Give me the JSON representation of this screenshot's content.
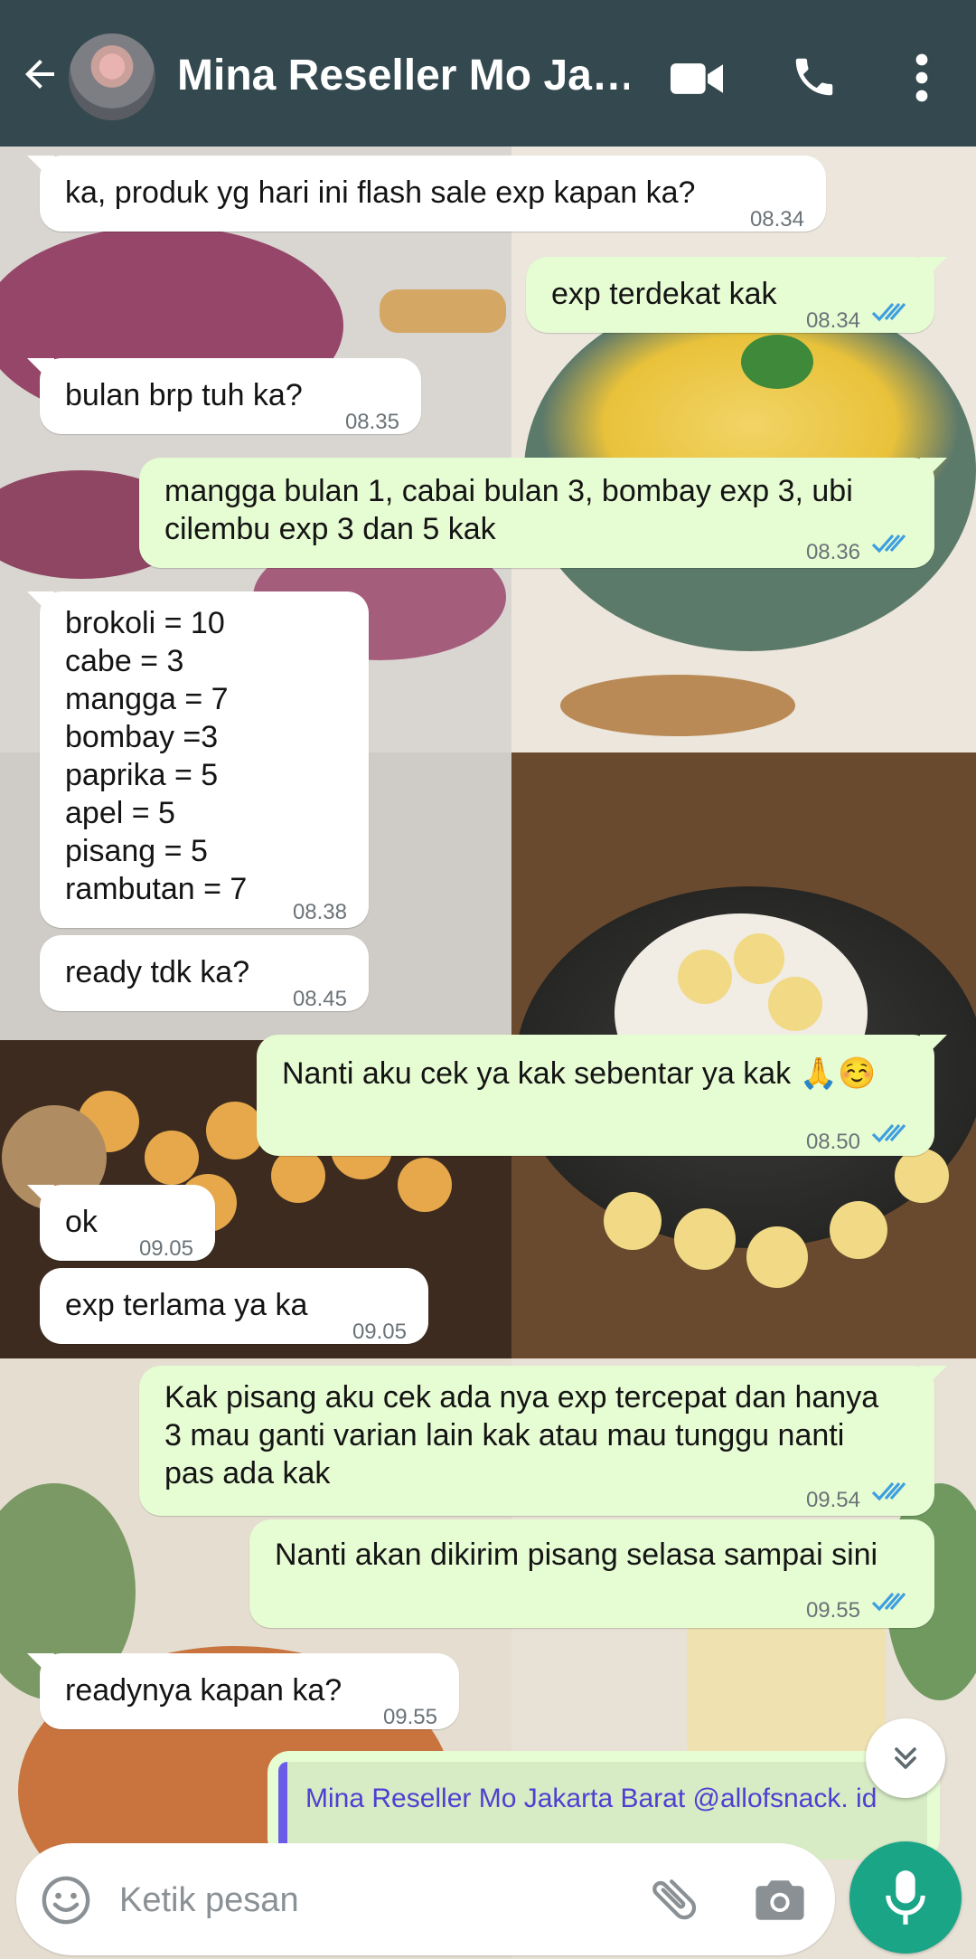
{
  "header": {
    "contact_name": "Mina Reseller Mo Ja…"
  },
  "messages": [
    {
      "dir": "in",
      "text": "ka, produk yg hari ini flash sale exp kapan ka?",
      "time": "08.34"
    },
    {
      "dir": "out",
      "text": "exp terdekat kak",
      "time": "08.34",
      "status": "read"
    },
    {
      "dir": "in",
      "text": "bulan brp tuh ka?",
      "time": "08.35"
    },
    {
      "dir": "out",
      "text": "mangga bulan 1, cabai bulan 3, bombay exp 3, ubi\ncilembu exp 3 dan 5 kak",
      "time": "08.36",
      "status": "read"
    },
    {
      "dir": "in",
      "text": "brokoli = 10\ncabe = 3\nmangga = 7\nbombay =3\npaprika = 5\napel = 5\npisang = 5\nrambutan = 7",
      "time": "08.38"
    },
    {
      "dir": "in",
      "text": "ready tdk ka?",
      "time": "08.45"
    },
    {
      "dir": "out",
      "text": "Nanti aku cek ya kak sebentar ya kak 🙏☺️",
      "time": "08.50",
      "status": "read"
    },
    {
      "dir": "in",
      "text": "ok",
      "time": "09.05"
    },
    {
      "dir": "in",
      "text": "exp terlama ya ka",
      "time": "09.05"
    },
    {
      "dir": "out",
      "text": "Kak pisang aku cek ada nya exp tercepat dan hanya\n3 mau ganti varian lain kak atau mau tunggu nanti\npas ada kak",
      "time": "09.54",
      "status": "read"
    },
    {
      "dir": "out",
      "text": "Nanti akan dikirim pisang selasa sampai sini",
      "time": "09.55",
      "status": "read"
    },
    {
      "dir": "in",
      "text": "readynya kapan ka?",
      "time": "09.55"
    }
  ],
  "quoted_message": {
    "sender": "Mina Reseller Mo Jakarta Barat @allofsnack. id"
  },
  "composer": {
    "placeholder": "Ketik pesan"
  },
  "icons": {
    "back": "arrow-back-icon",
    "video": "video-camera-icon",
    "call": "phone-icon",
    "more": "more-vert-icon",
    "emoji": "emoji-icon",
    "attach": "paperclip-icon",
    "camera": "camera-icon",
    "mic": "microphone-icon",
    "scroll": "double-chevron-down-icon"
  },
  "colors": {
    "header_bg": "#34494f",
    "incoming_bubble": "#ffffff",
    "outgoing_bubble": "#e6fcd3",
    "read_ticks": "#3d9fe0",
    "mic_button": "#1aa587",
    "quote_accent": "#6b5ce7"
  }
}
